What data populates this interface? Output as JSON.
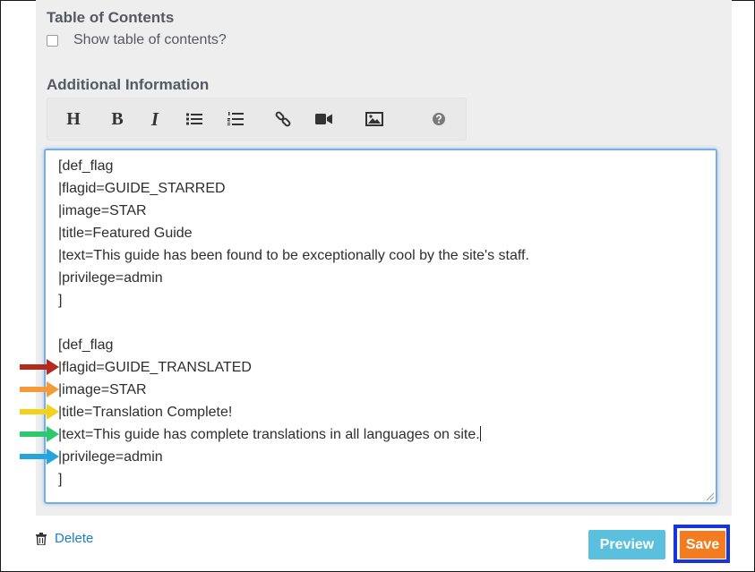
{
  "toc": {
    "heading": "Table of Contents",
    "checkbox_label": "Show table of contents?"
  },
  "additional": {
    "heading": "Additional Information"
  },
  "toolbar": {
    "heading_label": "H",
    "bold_label": "B",
    "italic_label": "I",
    "icons": [
      "bulleted-list-icon",
      "numbered-list-icon",
      "link-icon",
      "video-icon",
      "image-icon",
      "help-icon"
    ]
  },
  "editor": {
    "lines": [
      "[def_flag",
      "|flagid=GUIDE_STARRED",
      "|image=STAR",
      "|title=Featured Guide",
      "|text=This guide has been found to be exceptionally cool by the site's staff.",
      "|privilege=admin",
      "]",
      "",
      "[def_flag",
      "|flagid=GUIDE_TRANSLATED",
      "|image=STAR",
      "|title=Translation Complete!",
      "|text=This guide has complete translations in all languages on site.",
      "|privilege=admin",
      "]"
    ]
  },
  "arrows": {
    "colors": [
      "#b42a1c",
      "#f39a3a",
      "#f2d21b",
      "#2ec96e",
      "#27a3de"
    ]
  },
  "footer": {
    "delete_label": "Delete",
    "preview_label": "Preview",
    "save_label": "Save"
  },
  "colors": {
    "link": "#1d7fbd",
    "preview": "#5bc0de",
    "save": "#f27c1f",
    "highlight": "#1735d8",
    "editor_focus": "#77aee8"
  }
}
